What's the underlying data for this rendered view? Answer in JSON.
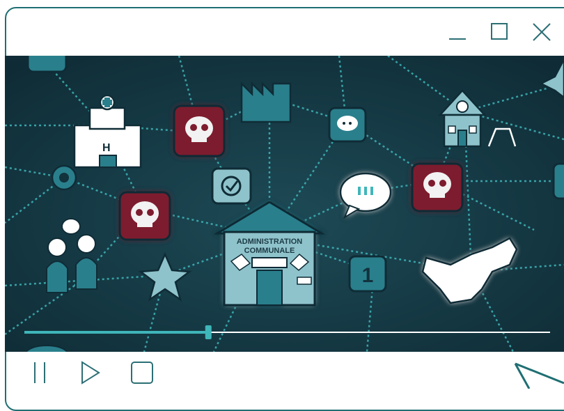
{
  "window": {
    "minimize_icon": "minimize-icon",
    "maximize_icon": "maximize-icon",
    "close_icon": "close-icon"
  },
  "video": {
    "building_label_line1": "ADMINISTRATION",
    "building_label_line2": "COMMUNALE",
    "progress": 0.35,
    "accent": "#3fb6b9",
    "background": "#12323d"
  },
  "controls": {
    "pause_icon": "pause-icon",
    "play_icon": "play-icon",
    "stop_icon": "stop-icon",
    "cursor_icon": "cursor-arrow-icon"
  },
  "colors": {
    "frame": "#1f6f73",
    "skull_tile": "#7d1e2d",
    "teal_icon": "#2a7f8c"
  }
}
